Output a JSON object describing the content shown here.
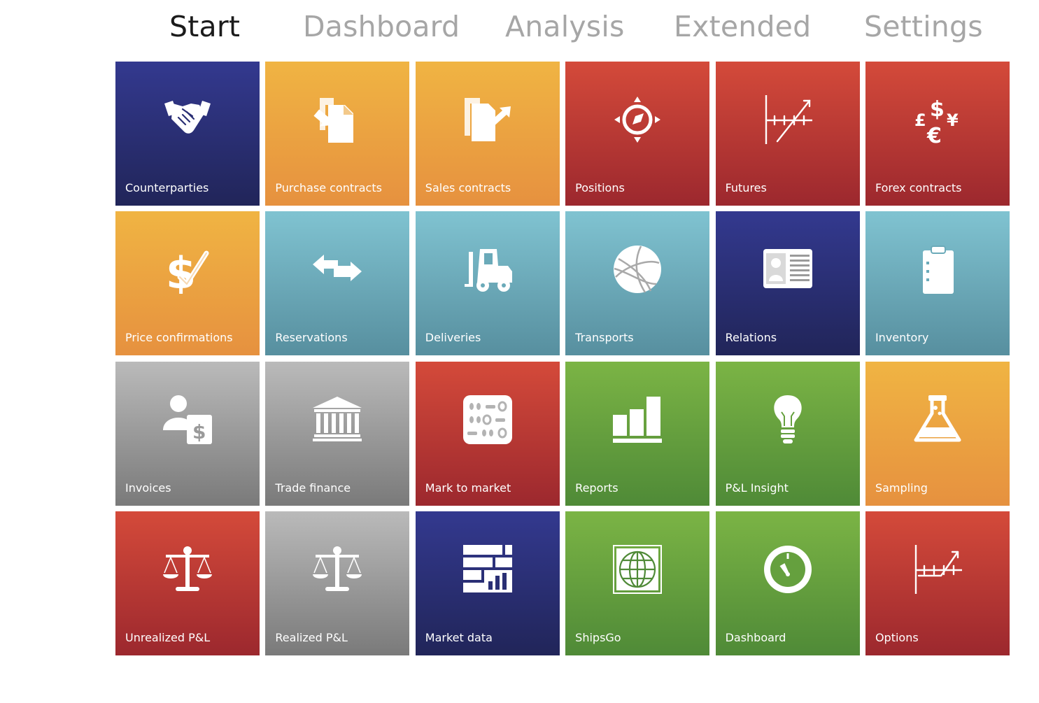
{
  "nav": {
    "tabs": [
      {
        "label": "Start",
        "active": true
      },
      {
        "label": "Dashboard",
        "active": false
      },
      {
        "label": "Analysis",
        "active": false
      },
      {
        "label": "Extended",
        "active": false
      },
      {
        "label": "Settings",
        "active": false
      }
    ]
  },
  "colors": {
    "blue": "#2a2f74",
    "orange": "#ec9f40",
    "red": "#c23c36",
    "teal": "#6baab9",
    "gray": "#9a9a9a",
    "green": "#65a03e",
    "active_tab": "#1b1b1b",
    "inactive_tab": "#a6a6a6"
  },
  "tiles": [
    {
      "label": "Counterparties",
      "icon": "handshake-icon",
      "color": "blue"
    },
    {
      "label": "Purchase contracts",
      "icon": "purchase-documents-icon",
      "color": "orange"
    },
    {
      "label": "Sales contracts",
      "icon": "sales-documents-icon",
      "color": "orange"
    },
    {
      "label": "Positions",
      "icon": "compass-icon",
      "color": "red"
    },
    {
      "label": "Futures",
      "icon": "futures-chart-icon",
      "color": "red"
    },
    {
      "label": "Forex contracts",
      "icon": "currency-icon",
      "color": "red"
    },
    {
      "label": "Price confirmations",
      "icon": "dollar-check-icon",
      "color": "orange"
    },
    {
      "label": "Reservations",
      "icon": "swap-arrows-icon",
      "color": "teal"
    },
    {
      "label": "Deliveries",
      "icon": "forklift-icon",
      "color": "teal"
    },
    {
      "label": "Transports",
      "icon": "globe-icon",
      "color": "teal"
    },
    {
      "label": "Relations",
      "icon": "id-card-icon",
      "color": "blue"
    },
    {
      "label": "Inventory",
      "icon": "clipboard-icon",
      "color": "teal"
    },
    {
      "label": "Invoices",
      "icon": "person-invoice-icon",
      "color": "gray"
    },
    {
      "label": "Trade finance",
      "icon": "bank-icon",
      "color": "gray"
    },
    {
      "label": "Mark to market",
      "icon": "calculator-icon",
      "color": "red"
    },
    {
      "label": "Reports",
      "icon": "bar-chart-icon",
      "color": "green"
    },
    {
      "label": "P&L Insight",
      "icon": "lightbulb-icon",
      "color": "green"
    },
    {
      "label": "Sampling",
      "icon": "flask-icon",
      "color": "orange"
    },
    {
      "label": "Unrealized P&L",
      "icon": "scale-icon",
      "color": "red"
    },
    {
      "label": "Realized P&L",
      "icon": "scale-icon",
      "color": "gray"
    },
    {
      "label": "Market data",
      "icon": "market-data-icon",
      "color": "blue"
    },
    {
      "label": "ShipsGo",
      "icon": "world-grid-icon",
      "color": "green"
    },
    {
      "label": "Dashboard",
      "icon": "gauge-icon",
      "color": "green"
    },
    {
      "label": "Options",
      "icon": "options-chart-icon",
      "color": "red"
    }
  ]
}
